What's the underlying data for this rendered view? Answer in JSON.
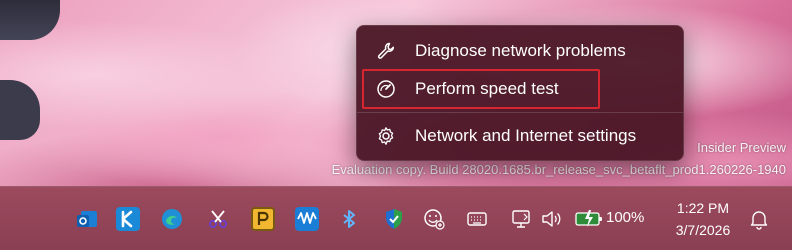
{
  "context_menu": {
    "items": [
      {
        "label": "Diagnose network problems",
        "icon": "wrench-icon"
      },
      {
        "label": "Perform speed test",
        "icon": "speedometer-icon",
        "highlighted": true
      },
      {
        "label": "Network and Internet settings",
        "icon": "gear-icon"
      }
    ]
  },
  "watermark": {
    "line1": "Insider Preview",
    "line2": "Evaluation copy. Build 28020.1685.br_release_svc_betaflt_prod1.260226-1940"
  },
  "taskbar": {
    "apps": [
      {
        "name": "outlook-icon",
        "color": "#1c7fd6"
      },
      {
        "name": "k-app-icon",
        "color": "#1a8ad8"
      },
      {
        "name": "edge-icon",
        "color": "#1f8fd6"
      },
      {
        "name": "snipping-tool-icon",
        "color": "#6b3fc9"
      },
      {
        "name": "p-app-icon",
        "color": "#f2b731"
      },
      {
        "name": "waveform-app-icon",
        "color": "#1a7ed6"
      },
      {
        "name": "bluetooth-icon",
        "color": "#1577e0"
      },
      {
        "name": "security-shield-icon",
        "color": "#2d9f4a"
      },
      {
        "name": "emoji-icon",
        "color": "#ffffff"
      },
      {
        "name": "keyboard-icon",
        "color": "#ffffff"
      }
    ],
    "tray": {
      "battery_percent": "100%",
      "time": "1:22 PM",
      "date": "3/7/2026"
    }
  }
}
